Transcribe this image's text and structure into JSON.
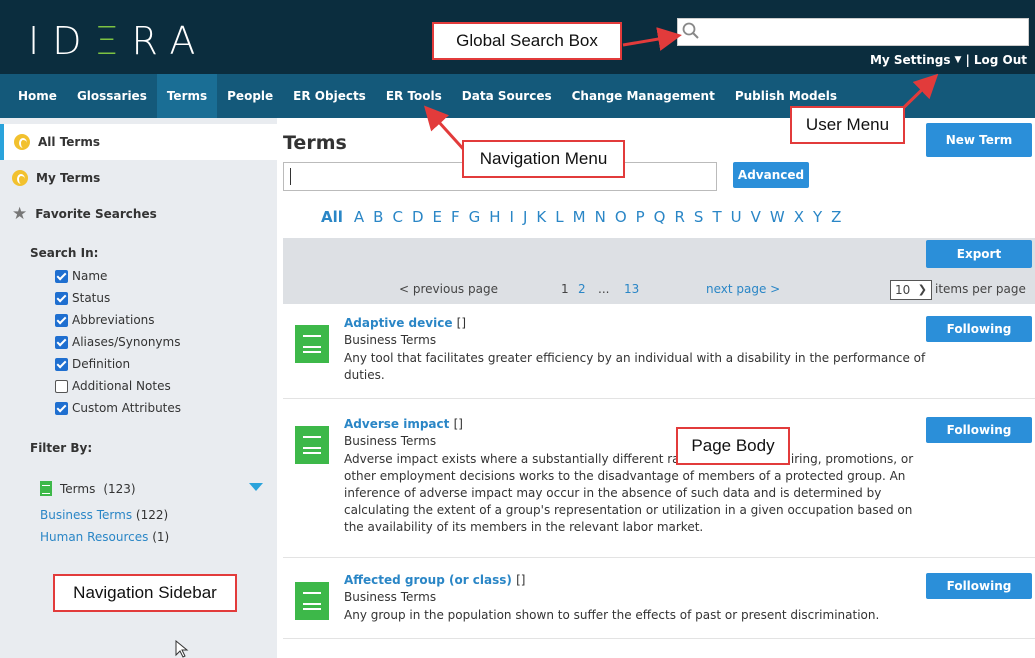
{
  "header": {
    "logo_left": "ID",
    "logo_accent": "Ξ",
    "logo_right": "RA",
    "search_placeholder": "",
    "my_settings": "My Settings",
    "separator": "|",
    "logout": "Log Out"
  },
  "nav": {
    "items": [
      "Home",
      "Glossaries",
      "Terms",
      "People",
      "ER Objects",
      "ER Tools",
      "Data Sources",
      "Change Management",
      "Publish Models"
    ],
    "active": "Terms"
  },
  "sidebar": {
    "all_terms": "All Terms",
    "my_terms": "My Terms",
    "favorite_searches": "Favorite Searches",
    "search_in": "Search In:",
    "search_in_options": [
      {
        "label": "Name",
        "checked": true
      },
      {
        "label": "Status",
        "checked": true
      },
      {
        "label": "Abbreviations",
        "checked": true
      },
      {
        "label": "Aliases/Synonyms",
        "checked": true
      },
      {
        "label": "Definition",
        "checked": true
      },
      {
        "label": "Additional Notes",
        "checked": false
      },
      {
        "label": "Custom Attributes",
        "checked": true
      }
    ],
    "filter_by": "Filter By:",
    "filter_group": "Terms",
    "filter_group_count": "(123)",
    "filters": [
      {
        "label": "Business Terms",
        "count": "(122)"
      },
      {
        "label": "Human Resources",
        "count": "(1)"
      }
    ]
  },
  "main": {
    "title": "Terms",
    "new_term": "New Term",
    "advanced": "Advanced",
    "alphabet": [
      "All",
      "A",
      "B",
      "C",
      "D",
      "E",
      "F",
      "G",
      "H",
      "I",
      "J",
      "K",
      "L",
      "M",
      "N",
      "O",
      "P",
      "Q",
      "R",
      "S",
      "T",
      "U",
      "V",
      "W",
      "X",
      "Y",
      "Z"
    ],
    "export": "Export",
    "pager": {
      "previous": "< previous page",
      "page1": "1",
      "page2": "2",
      "dots": "...",
      "page13": "13",
      "next": "next page >",
      "per_page_value": "10",
      "per_page_label": "items per page"
    },
    "terms": [
      {
        "name": "Adaptive device",
        "brackets": "[]",
        "category": "Business Terms",
        "definition": "Any tool that facilitates greater efficiency by an individual with a disability in the performance of duties.",
        "action": "Following"
      },
      {
        "name": "Adverse impact",
        "brackets": "[]",
        "category": "Business Terms",
        "definition": "Adverse impact exists where a substantially different rate of selection in hiring, promotions, or other employment decisions works to the disadvantage of members of a protected group. An inference of adverse impact may occur in the absence of such data and is determined by calculating the extent of a group's representation or utilization in a given occupation based on the availability of its members in the relevant labor market.",
        "action": "Following"
      },
      {
        "name": "Affected group (or class)",
        "brackets": "[]",
        "category": "Business Terms",
        "definition": "Any group in the population shown to suffer the effects of past or present discrimination.",
        "action": "Following"
      }
    ]
  },
  "callouts": {
    "global_search": "Global Search Box",
    "user_menu": "User Menu",
    "navigation_menu": "Navigation Menu",
    "page_body": "Page Body",
    "navigation_sidebar": "Navigation Sidebar"
  },
  "colors": {
    "header_bg": "#0b2d3e",
    "nav_bg": "#14597a",
    "accent_blue": "#2b8fd9",
    "term_green": "#3db849",
    "callout_red": "#e23b3b"
  }
}
